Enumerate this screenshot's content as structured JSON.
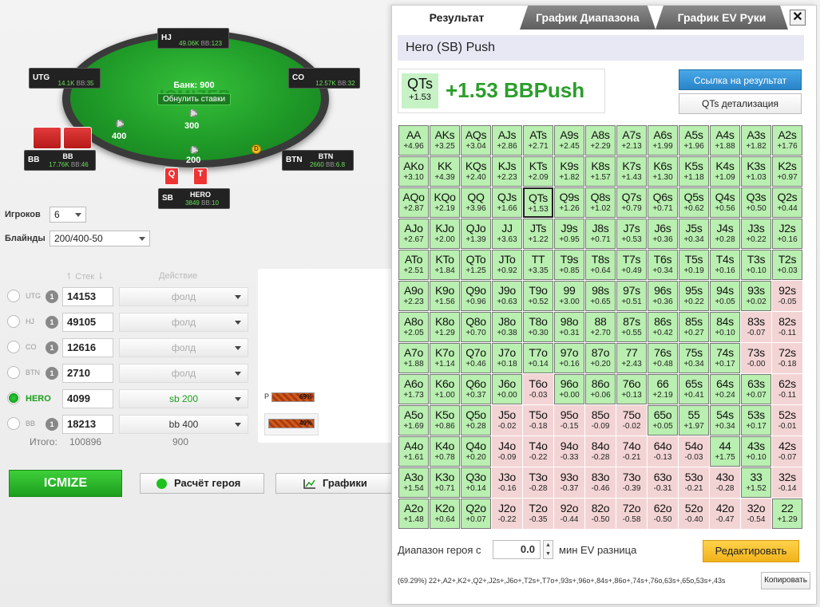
{
  "table": {
    "pot_label": "Банк: 900",
    "reset_label": "Обнулить ставки",
    "watermark": "ICMIZER",
    "bets": {
      "center": "300",
      "utg_side": "400",
      "sb_side": "200"
    },
    "dealer": "D",
    "seats": {
      "hj": {
        "pos": "HJ",
        "stack": "49.06K",
        "bb_label": "BB:",
        "bb": "123"
      },
      "utg": {
        "pos": "UTG",
        "stack": "14.1K",
        "bb_label": "BB:",
        "bb": "35"
      },
      "co": {
        "pos": "CO",
        "stack": "12.57K",
        "bb_label": "BB:",
        "bb": "32"
      },
      "bb": {
        "pos": "BB",
        "stack": "17.76K",
        "bb_label": "BB:",
        "bb": "46"
      },
      "btn": {
        "pos": "BTN",
        "stack": "2660",
        "bb_label": "BB:",
        "bb": "6.8"
      },
      "sb": {
        "pos": "SB",
        "name": "HERO",
        "stack": "3849",
        "bb_label": "BB:",
        "bb": "10"
      }
    },
    "hero_cards": [
      "Q",
      "T"
    ]
  },
  "controls": {
    "players_label": "Игроков",
    "players_value": "6",
    "blinds_label": "Блайнды",
    "blinds_value": "200/400-50",
    "stack_header": "Стек",
    "action_header": "Действие",
    "rows": [
      {
        "pos": "UTG",
        "num": "1",
        "stack": "14153",
        "action": "фолд"
      },
      {
        "pos": "HJ",
        "num": "1",
        "stack": "49105",
        "action": "фолд"
      },
      {
        "pos": "CO",
        "num": "1",
        "stack": "12616",
        "action": "фолд"
      },
      {
        "pos": "BTN",
        "num": "1",
        "stack": "2710",
        "action": "фолд"
      },
      {
        "pos": "HERO",
        "num": "",
        "stack": "4099",
        "action": "sb 200"
      },
      {
        "pos": "BB",
        "num": "1",
        "stack": "18213",
        "action": "bb 400"
      }
    ],
    "total_label": "Итого:",
    "total_stack": "100896",
    "total_bets": "900",
    "equity": [
      {
        "label": "P",
        "pct": "69%",
        "fill": 0.69
      },
      {
        "label": "",
        "pct": "49%",
        "fill": 0.49
      }
    ],
    "icmize_label": "ICMIZE",
    "hero_calc_label": "Расчёт героя",
    "charts_label": "Графики"
  },
  "panel": {
    "tabs": [
      "Результат",
      "График Диапазона",
      "График EV Руки"
    ],
    "close": "✕",
    "title": "Hero (SB) Push",
    "hand": "QTs",
    "hand_ev": "+1.53",
    "ev_big": "+1.53 BBPush",
    "link_button": "Ссылка на результат",
    "detail_button": "QTs детализация",
    "range_label": "Диапазон героя с",
    "ev_value": "0.0",
    "ev_label": "мин EV разница",
    "edit_button": "Редактировать",
    "range_string": "(69.29%) 22+,A2+,K2+,Q2+,J2s+,J6o+,T2s+,T7o+,93s+,96o+,84s+,86o+,74s+,76o,63s+,65o,53s+,43s",
    "copy_button": "Копировать"
  },
  "grid": [
    [
      "AA",
      "+4.96",
      "AKs",
      "+3.25",
      "AQs",
      "+3.04",
      "AJs",
      "+2.86",
      "ATs",
      "+2.71",
      "A9s",
      "+2.45",
      "A8s",
      "+2.29",
      "A7s",
      "+2.13",
      "A6s",
      "+1.99",
      "A5s",
      "+1.96",
      "A4s",
      "+1.88",
      "A3s",
      "+1.82",
      "A2s",
      "+1.76"
    ],
    [
      "AKo",
      "+3.10",
      "KK",
      "+4.39",
      "KQs",
      "+2.40",
      "KJs",
      "+2.23",
      "KTs",
      "+2.09",
      "K9s",
      "+1.82",
      "K8s",
      "+1.57",
      "K7s",
      "+1.43",
      "K6s",
      "+1.30",
      "K5s",
      "+1.18",
      "K4s",
      "+1.09",
      "K3s",
      "+1.03",
      "K2s",
      "+0.97"
    ],
    [
      "AQo",
      "+2.87",
      "KQo",
      "+2.19",
      "QQ",
      "+3.96",
      "QJs",
      "+1.66",
      "QTs",
      "+1.53",
      "Q9s",
      "+1.26",
      "Q8s",
      "+1.02",
      "Q7s",
      "+0.79",
      "Q6s",
      "+0.71",
      "Q5s",
      "+0.62",
      "Q4s",
      "+0.56",
      "Q3s",
      "+0.50",
      "Q2s",
      "+0.44"
    ],
    [
      "AJo",
      "+2.67",
      "KJo",
      "+2.00",
      "QJo",
      "+1.39",
      "JJ",
      "+3.63",
      "JTs",
      "+1.22",
      "J9s",
      "+0.95",
      "J8s",
      "+0.71",
      "J7s",
      "+0.53",
      "J6s",
      "+0.36",
      "J5s",
      "+0.34",
      "J4s",
      "+0.28",
      "J3s",
      "+0.22",
      "J2s",
      "+0.16"
    ],
    [
      "ATo",
      "+2.51",
      "KTo",
      "+1.84",
      "QTo",
      "+1.25",
      "JTo",
      "+0.92",
      "TT",
      "+3.35",
      "T9s",
      "+0.85",
      "T8s",
      "+0.64",
      "T7s",
      "+0.49",
      "T6s",
      "+0.34",
      "T5s",
      "+0.19",
      "T4s",
      "+0.16",
      "T3s",
      "+0.10",
      "T2s",
      "+0.03"
    ],
    [
      "A9o",
      "+2.23",
      "K9o",
      "+1.56",
      "Q9o",
      "+0.96",
      "J9o",
      "+0.63",
      "T9o",
      "+0.52",
      "99",
      "+3.00",
      "98s",
      "+0.65",
      "97s",
      "+0.51",
      "96s",
      "+0.36",
      "95s",
      "+0.22",
      "94s",
      "+0.05",
      "93s",
      "+0.02",
      "92s",
      "-0.05"
    ],
    [
      "A8o",
      "+2.05",
      "K8o",
      "+1.29",
      "Q8o",
      "+0.70",
      "J8o",
      "+0.38",
      "T8o",
      "+0.30",
      "98o",
      "+0.31",
      "88",
      "+2.70",
      "87s",
      "+0.55",
      "86s",
      "+0.42",
      "85s",
      "+0.27",
      "84s",
      "+0.10",
      "83s",
      "-0.07",
      "82s",
      "-0.11"
    ],
    [
      "A7o",
      "+1.88",
      "K7o",
      "+1.14",
      "Q7o",
      "+0.46",
      "J7o",
      "+0.18",
      "T7o",
      "+0.14",
      "97o",
      "+0.16",
      "87o",
      "+0.20",
      "77",
      "+2.43",
      "76s",
      "+0.48",
      "75s",
      "+0.34",
      "74s",
      "+0.17",
      "73s",
      "-0.00",
      "72s",
      "-0.18"
    ],
    [
      "A6o",
      "+1.73",
      "K6o",
      "+1.00",
      "Q6o",
      "+0.37",
      "J6o",
      "+0.00",
      "T6o",
      "-0.03",
      "96o",
      "+0.00",
      "86o",
      "+0.06",
      "76o",
      "+0.13",
      "66",
      "+2.19",
      "65s",
      "+0.41",
      "64s",
      "+0.24",
      "63s",
      "+0.07",
      "62s",
      "-0.11"
    ],
    [
      "A5o",
      "+1.69",
      "K5o",
      "+0.86",
      "Q5o",
      "+0.28",
      "J5o",
      "-0.02",
      "T5o",
      "-0.18",
      "95o",
      "-0.15",
      "85o",
      "-0.09",
      "75o",
      "-0.02",
      "65o",
      "+0.05",
      "55",
      "+1.97",
      "54s",
      "+0.34",
      "53s",
      "+0.17",
      "52s",
      "-0.01"
    ],
    [
      "A4o",
      "+1.61",
      "K4o",
      "+0.78",
      "Q4o",
      "+0.20",
      "J4o",
      "-0.09",
      "T4o",
      "-0.22",
      "94o",
      "-0.33",
      "84o",
      "-0.28",
      "74o",
      "-0.21",
      "64o",
      "-0.13",
      "54o",
      "-0.03",
      "44",
      "+1.75",
      "43s",
      "+0.10",
      "42s",
      "-0.07"
    ],
    [
      "A3o",
      "+1.54",
      "K3o",
      "+0.71",
      "Q3o",
      "+0.14",
      "J3o",
      "-0.16",
      "T3o",
      "-0.28",
      "93o",
      "-0.37",
      "83o",
      "-0.46",
      "73o",
      "-0.39",
      "63o",
      "-0.31",
      "53o",
      "-0.21",
      "43o",
      "-0.28",
      "33",
      "+1.52",
      "32s",
      "-0.14"
    ],
    [
      "A2o",
      "+1.48",
      "K2o",
      "+0.64",
      "Q2o",
      "+0.07",
      "J2o",
      "-0.22",
      "T2o",
      "-0.35",
      "92o",
      "-0.44",
      "82o",
      "-0.50",
      "72o",
      "-0.58",
      "62o",
      "-0.50",
      "52o",
      "-0.40",
      "42o",
      "-0.47",
      "32o",
      "-0.54",
      "22",
      "+1.29"
    ]
  ],
  "colors": {
    "accent_green": "#1aa01a",
    "push_cell": "#b9efb0",
    "fold_cell": "#f3d4d4",
    "button_blue": "#2a84c8",
    "button_orange": "#f2b21a"
  }
}
